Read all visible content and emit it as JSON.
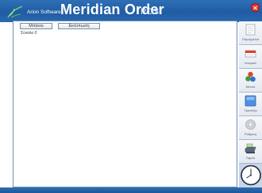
{
  "header": {
    "brand_small": "Arion Software",
    "brand_large": "Meridian Order",
    "brand_suffix": "POS"
  },
  "tabs": {
    "main": "Μπάνιο",
    "search": "Εκτύπωση"
  },
  "content": {
    "total": "Σύνολο 0"
  },
  "sidebar": {
    "items": [
      {
        "label": "Παραγγελία",
        "icon": "order-list-icon"
      },
      {
        "label": "Ιστορικό",
        "icon": "history-icon"
      },
      {
        "label": "Μενού",
        "icon": "menu-icon"
      },
      {
        "label": "Τραπέζια",
        "icon": "tables-icon"
      },
      {
        "label": "Ρύθμιση",
        "icon": "settings-icon"
      },
      {
        "label": "Ταμείο",
        "icon": "cash-register-icon"
      }
    ]
  },
  "colors": {
    "titlebar": "#1f5ca3",
    "panel_border": "#6a8fb8",
    "sidebar_bg": "#c8d6e8",
    "close": "#e03228"
  }
}
